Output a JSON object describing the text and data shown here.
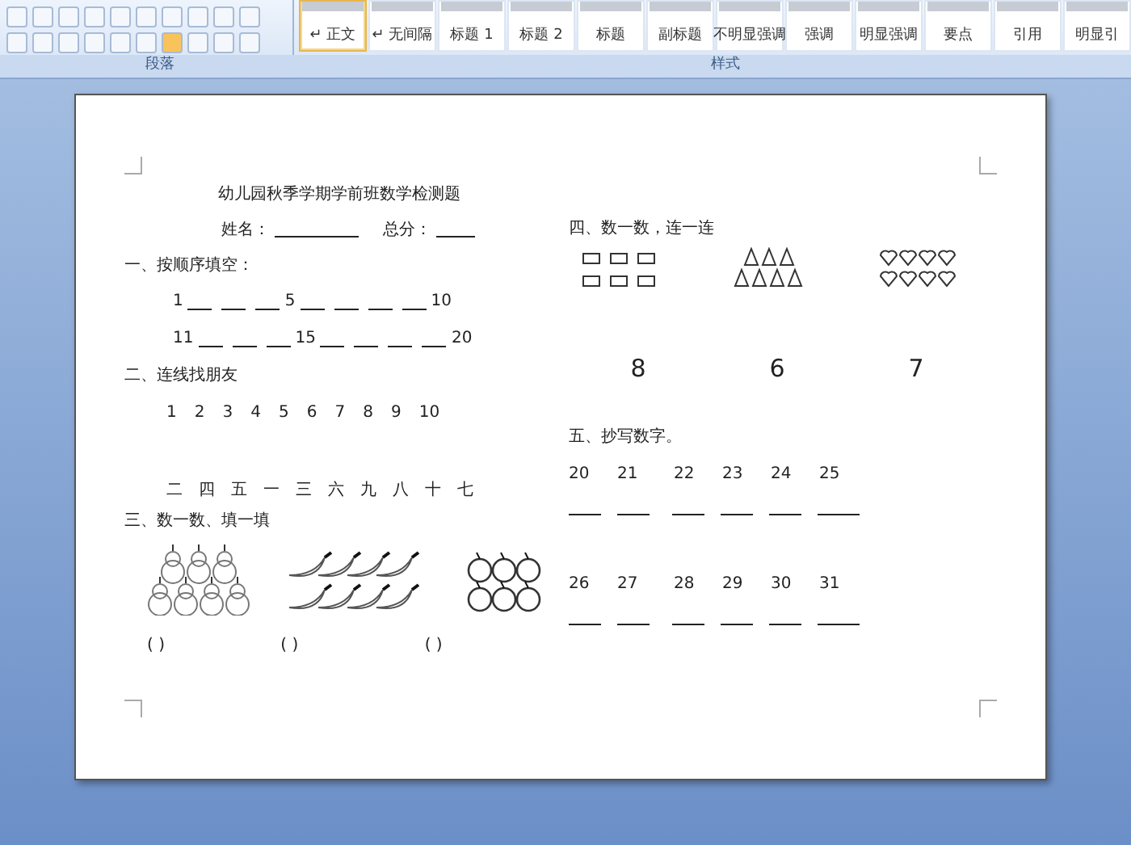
{
  "ribbon": {
    "groups": [
      "段落",
      "样式"
    ],
    "styles": [
      {
        "label": "↵ 正文",
        "selected": true
      },
      {
        "label": "↵ 无间隔",
        "selected": false
      },
      {
        "label": "标题 1",
        "selected": false
      },
      {
        "label": "标题 2",
        "selected": false
      },
      {
        "label": "标题",
        "selected": false
      },
      {
        "label": "副标题",
        "selected": false
      },
      {
        "label": "不明显强调",
        "selected": false
      },
      {
        "label": "强调",
        "selected": false
      },
      {
        "label": "明显强调",
        "selected": false
      },
      {
        "label": "要点",
        "selected": false
      },
      {
        "label": "引用",
        "selected": false
      },
      {
        "label": "明显引",
        "selected": false
      }
    ]
  },
  "document": {
    "title": "幼儿园秋季学期学前班数学检测题",
    "name_label": "姓名：",
    "score_label": "总分：",
    "section_1": {
      "heading": "一、按顺序填空：",
      "rows": [
        [
          "1",
          "5",
          "10"
        ],
        [
          "11",
          "15",
          "20"
        ]
      ]
    },
    "section_2": {
      "heading": "二、连线找朋友",
      "digits": [
        "1",
        "2",
        "3",
        "4",
        "5",
        "6",
        "7",
        "8",
        "9",
        "10"
      ],
      "words": [
        "二",
        "四",
        "五",
        "一",
        "三",
        "六",
        "九",
        "八",
        "十",
        "七"
      ]
    },
    "section_3": {
      "heading": "三、数一数、填一填",
      "groups": [
        {
          "kind": "pear",
          "answer": "(      )"
        },
        {
          "kind": "pepper",
          "answer": "(      )"
        },
        {
          "kind": "apple",
          "answer": "(      )"
        }
      ]
    },
    "section_4": {
      "heading": "四、数一数，连一连",
      "groups": [
        {
          "kind": "rectangle"
        },
        {
          "kind": "triangle"
        },
        {
          "kind": "heart"
        }
      ],
      "numbers": [
        "8",
        "6",
        "7"
      ]
    },
    "section_5": {
      "heading": "五、抄写数字。",
      "rows": [
        [
          "20",
          "21",
          "22",
          "23",
          "24",
          "25"
        ],
        [
          "26",
          "27",
          "28",
          "29",
          "30",
          "31"
        ]
      ]
    }
  }
}
